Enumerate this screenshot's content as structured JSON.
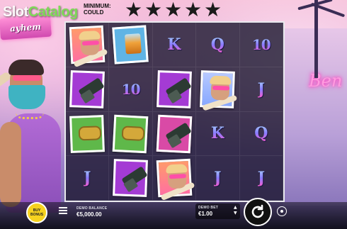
{
  "watermark": {
    "slot": "Slot",
    "catalog": "Catalog"
  },
  "logo": {
    "text": "ayhem"
  },
  "header": {
    "min_label": "MINIMUM: COULD",
    "stars": [
      "★",
      "★",
      "★",
      "★",
      "★"
    ]
  },
  "background": {
    "neon_sign": "Ben"
  },
  "grid": {
    "rows": [
      [
        "portrait",
        "whisky",
        "K",
        "Q",
        "10"
      ],
      [
        "gun-purple",
        "10",
        "gun-purple",
        "portrait-blue",
        "J"
      ],
      [
        "knuckles",
        "knuckles",
        "gun-pink",
        "K",
        "Q"
      ],
      [
        "J",
        "gun-purple",
        "portrait",
        "J",
        "J"
      ]
    ]
  },
  "controls": {
    "buy_bonus": "BUY BONUS",
    "balance_label": "DEMO BALANCE",
    "balance_value": "€5,000.00",
    "bet_label": "DEMO BET",
    "bet_value": "€1.00"
  },
  "colors": {
    "accent": "#f6d21f",
    "frame": "#e9e9ee",
    "letter_gradient_top": "#a8d6ff",
    "letter_gradient_bottom": "#ff5ac8"
  }
}
